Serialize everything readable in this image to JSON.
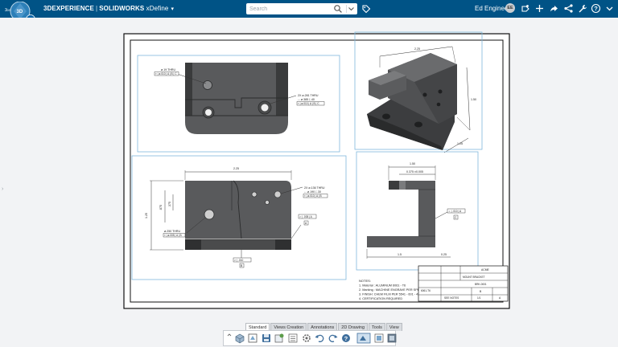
{
  "app": {
    "compass_label": "3D",
    "compass_version": "V,R",
    "brand_experience": "3DEXPERIENCE",
    "brand_solidworks": "SOLIDWORKS",
    "brand_app": "xDefine",
    "user_name": "Ed Engineer",
    "user_initials": "EE",
    "accent_color": "#005386"
  },
  "search": {
    "placeholder": "Search",
    "value": ""
  },
  "top_icons": [
    "search-icon",
    "chevron-down-icon",
    "tag-icon",
    "notifications-icon",
    "add-icon",
    "share-icon",
    "tools-icon",
    "help-icon"
  ],
  "drawing": {
    "views": {
      "top": {
        "note_tl": "ø.19 THRU",
        "gdt_tl": "⌖ | ø.010 | A | B | C",
        "note_r1": "2X ø.281 THRU",
        "note_r2": "⌴ ø.385 ↧.40",
        "gdt_r": "⌖ | ø.010 | A | B | C"
      },
      "front": {
        "dim_top": "2.25",
        "dim_left1": "1.25",
        "dim_left2": ".875",
        "dim_left3": ".375",
        "note_r1": "2X ø.136 THRU",
        "note_r2": "⌴ ø.190 ↧.30",
        "gdt_r": "⌖ | ø.010 | A | B",
        "note_l": "ø.250 THRU",
        "gdt_l": "⌖ | ø.005 | A | B",
        "gdt_flat": "⏥ | .005 | A",
        "datum_a": "A",
        "gdt_bottom": "⏥ | .010",
        "datum_b": "B"
      },
      "iso": {
        "dim_top": "2.25",
        "dim_right": "1.50",
        "dim_diag": "1.25"
      },
      "right": {
        "dim_top": "1.50",
        "dim_top2": "0.375 ±0.005",
        "gdt": "⊥ | .010 | A",
        "datum_c": "C",
        "dim_bottom1": "1.5",
        "dim_bottom2": "0.25"
      }
    },
    "notes": {
      "title": "NOTES:",
      "lines": [
        "1. Material : ALUMINUM 6061 - T6",
        "2. Marking : MACHINE ENGRAVE PER SPEC",
        "3. FINISH: CHEM FILM PER 5541 - 601 - 45",
        "4. CERTIFICATION REQUIRED"
      ]
    },
    "titleblock": {
      "company": "ACME",
      "part_name": "MOUNT BRACKET",
      "part_no": "BRK-0001",
      "size": "B",
      "sheet": "1/1",
      "rev": "A",
      "material": "6061-T6",
      "finish": "SEE NOTES"
    }
  },
  "bottom_tabs": [
    {
      "label": "Standard",
      "active": true
    },
    {
      "label": "Views Creation",
      "active": false
    },
    {
      "label": "Annotations",
      "active": false
    },
    {
      "label": "2D Drawing",
      "active": false
    },
    {
      "label": "Tools",
      "active": false
    },
    {
      "label": "View",
      "active": false
    }
  ],
  "toolbar_icons": [
    "expand-icon",
    "part-icon",
    "drawing-icon",
    "save-icon",
    "new-icon",
    "properties-icon",
    "settings-icon",
    "undo-icon",
    "redo-icon",
    "help-icon",
    "sheet-icon",
    "view-icon",
    "display-icon"
  ]
}
